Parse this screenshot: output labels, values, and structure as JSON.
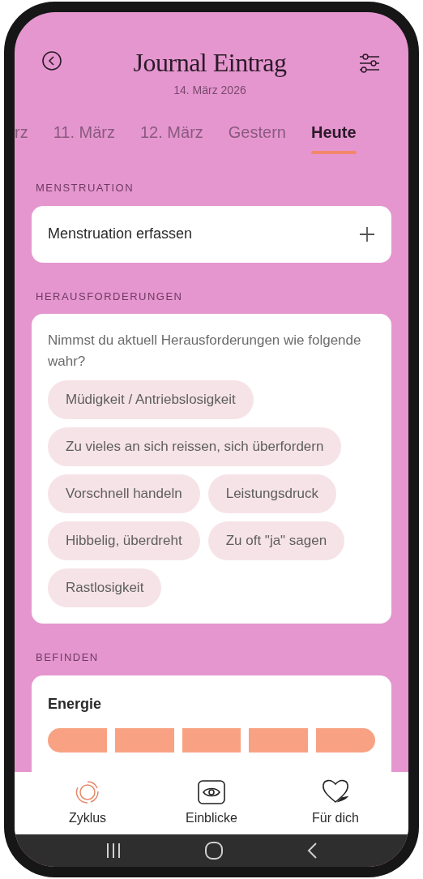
{
  "header": {
    "title": "Journal Eintrag",
    "date": "14. März 2026"
  },
  "tabs": [
    {
      "label": "rz",
      "selected": false
    },
    {
      "label": "11. März",
      "selected": false
    },
    {
      "label": "12. März",
      "selected": false
    },
    {
      "label": "Gestern",
      "selected": false
    },
    {
      "label": "Heute",
      "selected": true
    }
  ],
  "sections": [
    {
      "kind": "add",
      "heading": "MENSTRUATION",
      "label": "Menstruation erfassen"
    },
    {
      "kind": "chips",
      "heading": "HERAUSFORDERUNGEN",
      "question": "Nimmst du aktuell Herausforderungen wie folgende wahr?",
      "chips": [
        {
          "label": "Müdigkeit / Antriebslosigkeit",
          "selected": false
        },
        {
          "label": "Zu vieles an sich reissen, sich überfordern",
          "selected": false
        },
        {
          "label": "Vorschnell handeln",
          "selected": false
        },
        {
          "label": "Leistungsdruck",
          "selected": false
        },
        {
          "label": "Hibbelig, überdreht",
          "selected": false
        },
        {
          "label": "Zu oft \"ja\" sagen",
          "selected": false
        },
        {
          "label": "Rastlosigkeit",
          "selected": false
        }
      ]
    },
    {
      "kind": "scale",
      "heading": "BEFINDEN",
      "label": "Energie"
    }
  ],
  "bottom_nav": [
    {
      "kind": "cycle",
      "label": "Zyklus",
      "selected": true
    },
    {
      "kind": "eye",
      "label": "Einblicke",
      "selected": false
    },
    {
      "kind": "heart",
      "label": "Für dich",
      "selected": false
    }
  ]
}
